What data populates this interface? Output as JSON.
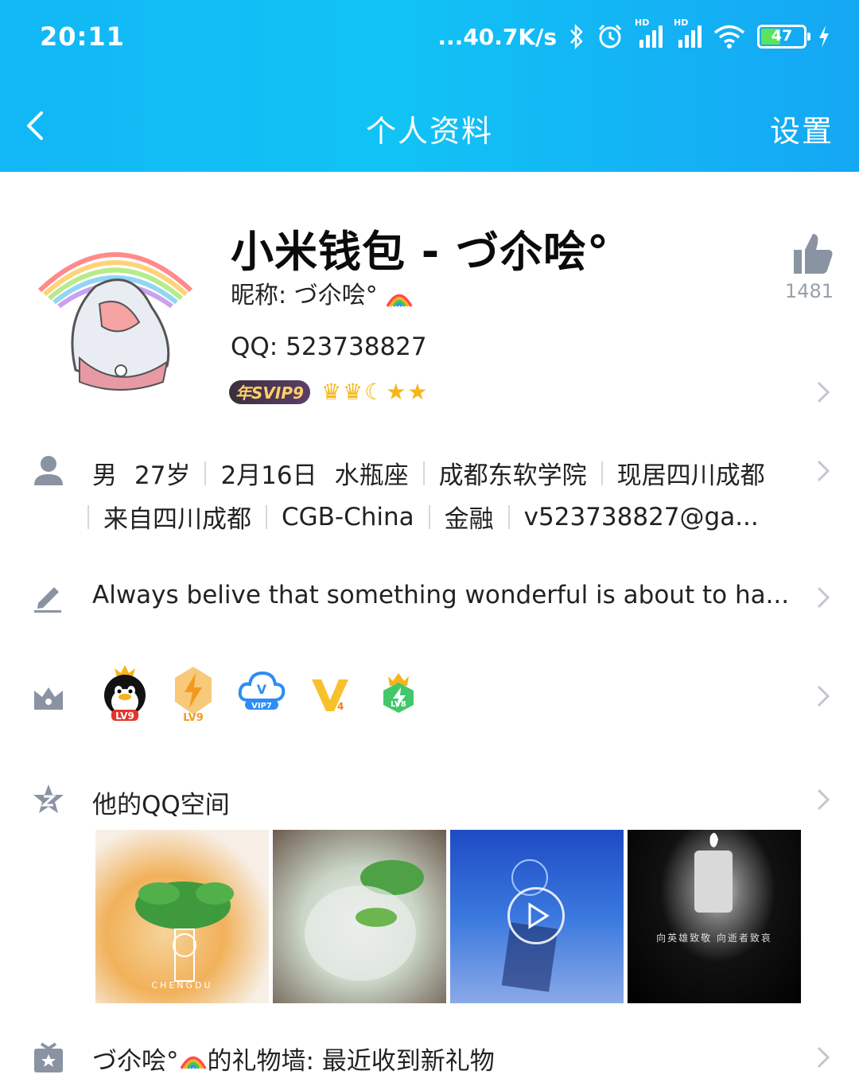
{
  "status_bar": {
    "time": "20:11",
    "net_speed": "...40.7K/s",
    "battery": "47",
    "hd1": "HD",
    "hd2": "HD"
  },
  "nav": {
    "title": "个人资料",
    "settings_label": "设置"
  },
  "profile": {
    "name": "小米钱包 - づ尒哙°",
    "nickname": "昵称: づ尒哙°",
    "qq": "QQ: 523738827",
    "svip_badge": "年SVIP9",
    "like_count": "1481"
  },
  "info": {
    "line1": [
      "男",
      "27岁",
      "2月16日",
      "水瓶座",
      "成都东软学院",
      "现居四川成都"
    ],
    "line2": [
      "来自四川成都",
      "CGB-China",
      "金融",
      "v523738827@ga..."
    ]
  },
  "bio": "Always belive that something wonderful is about to ha...",
  "levels": [
    "LV9",
    "LV9",
    "VIP7",
    "4",
    "LV8"
  ],
  "qzone": {
    "title": "他的QQ空间",
    "photos": [
      {
        "caption": "CHENGDU"
      },
      {
        "caption": ""
      },
      {
        "caption": ""
      },
      {
        "caption": "向英雄致敬 向逝者致哀"
      }
    ]
  },
  "gift": {
    "prefix": "づ尒哙°",
    "suffix": "的礼物墙: 最近收到新礼物"
  },
  "colors": {
    "header_start": "#12b7f5",
    "header_end": "#15a7f4",
    "icon_gray": "#8a93a2",
    "chevron": "#c3c7cd"
  }
}
